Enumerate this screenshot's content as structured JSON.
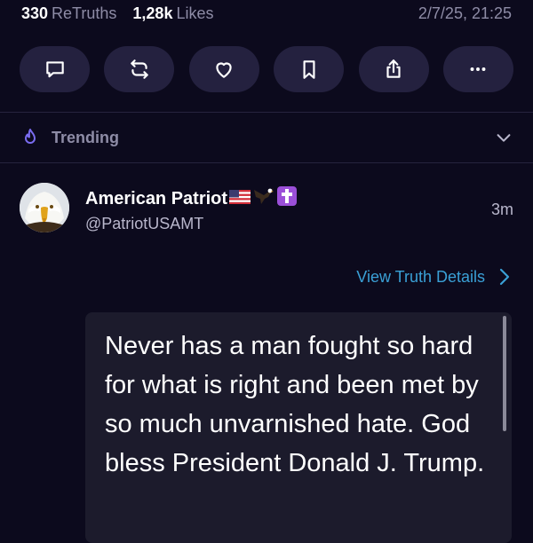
{
  "stats": {
    "retruths_count": "330",
    "retruths_label": "ReTruths",
    "likes_count": "1,28k",
    "likes_label": "Likes",
    "timestamp": "2/7/25, 21:25"
  },
  "actions": [
    {
      "icon": "reply-icon"
    },
    {
      "icon": "retruth-icon"
    },
    {
      "icon": "heart-icon"
    },
    {
      "icon": "bookmark-icon"
    },
    {
      "icon": "share-icon"
    },
    {
      "icon": "more-icon"
    }
  ],
  "trending": {
    "label": "Trending",
    "icon": "flame-icon",
    "accent_color": "#7a6cf0"
  },
  "author": {
    "display_name": "American Patriot",
    "emoji": [
      "🇺🇸",
      "🦅",
      "✝️"
    ],
    "handle": "@PatriotUSAMT",
    "time_ago": "3m"
  },
  "view_details": {
    "label": "View Truth Details",
    "color": "#3aa0d6"
  },
  "quote": {
    "text": "Never has a man fought so hard for what is right and been met by so much unvarnished hate. God bless President Donald J. Trump."
  }
}
